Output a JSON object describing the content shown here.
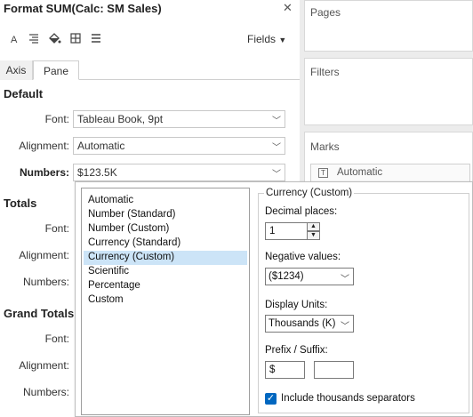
{
  "window": {
    "title": "Format SUM(Calc: SM Sales)"
  },
  "toolbar": {
    "icons": [
      "font-icon",
      "align-icon",
      "shading-icon",
      "borders-icon",
      "lines-icon"
    ],
    "fields_label": "Fields"
  },
  "tabs": [
    {
      "label": "Axis",
      "active": false
    },
    {
      "label": "Pane",
      "active": true
    }
  ],
  "default_section": {
    "heading": "Default",
    "font_label": "Font:",
    "font_value": "Tableau Book, 9pt",
    "alignment_label": "Alignment:",
    "alignment_value": "Automatic",
    "numbers_label": "Numbers:",
    "numbers_value": "$123.5K"
  },
  "totals_section": {
    "heading": "Totals",
    "font_label": "Font:",
    "alignment_label": "Alignment:",
    "numbers_label": "Numbers:"
  },
  "grand_totals_section": {
    "heading": "Grand Totals",
    "font_label": "Font:",
    "alignment_label": "Alignment:",
    "numbers_label": "Numbers:"
  },
  "right_cards": {
    "pages": "Pages",
    "filters": "Filters",
    "marks": "Marks",
    "marks_type": "Automatic"
  },
  "popup": {
    "format_list": [
      "Automatic",
      "Number (Standard)",
      "Number (Custom)",
      "Currency (Standard)",
      "Currency (Custom)",
      "Scientific",
      "Percentage",
      "Custom"
    ],
    "selected_format": "Currency (Custom)",
    "options_title": "Currency (Custom)",
    "decimal_label": "Decimal places:",
    "decimal_value": "1",
    "negative_label": "Negative values:",
    "negative_value": "($1234)",
    "units_label": "Display Units:",
    "units_value": "Thousands (K)",
    "prefix_label": "Prefix / Suffix:",
    "prefix_value": "$",
    "suffix_value": "",
    "thousands_label": "Include thousands separators",
    "thousands_checked": true
  },
  "colors": {
    "selected_row": "#cce4f7",
    "checkbox_accent": "#0067c0",
    "shelf_background": "#ececec"
  }
}
